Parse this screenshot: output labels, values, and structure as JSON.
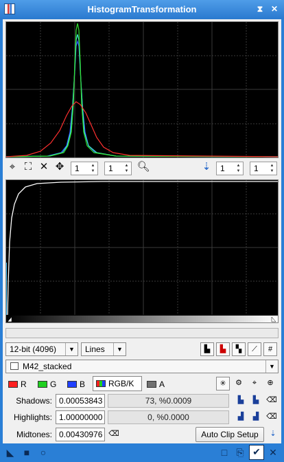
{
  "window": {
    "title": "HistogramTransformation"
  },
  "titlebar_icons": {
    "shade": "⧗",
    "close": "✕"
  },
  "hist_toolbar": {
    "zoom_h": "1",
    "zoom_v": "1",
    "zoom_h2": "1",
    "zoom_v2": "1"
  },
  "controls": {
    "bit_depth": "12-bit (4096)",
    "graph_style": "Lines",
    "view": "M42_stacked"
  },
  "channels": {
    "r": "R",
    "g": "G",
    "b": "B",
    "rgbk": "RGB/K",
    "a": "A"
  },
  "params": {
    "shadows_label": "Shadows:",
    "shadows_value": "0.00053843",
    "shadows_clip": "73, %0.0009",
    "highlights_label": "Highlights:",
    "highlights_value": "1.00000000",
    "highlights_clip": "0, %0.0000",
    "midtones_label": "Midtones:",
    "midtones_value": "0.00430976",
    "auto_clip": "Auto Clip Setup"
  },
  "colors": {
    "red": "#ff3030",
    "green": "#30e030",
    "blue": "#3050ff",
    "cyan": "#40e0d0",
    "accent": "#2a7fd6"
  }
}
